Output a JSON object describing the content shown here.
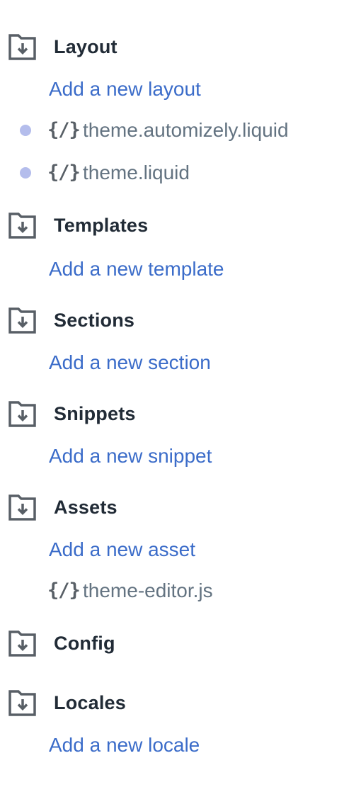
{
  "colors": {
    "link": "#3b6cc9",
    "heading": "#212b36",
    "file_text": "#637381",
    "icon": "#585f66",
    "dot": "#b4bdec"
  },
  "folders": [
    {
      "title": "Layout",
      "icon": "folder-download-icon",
      "add_label": "Add a new layout",
      "files": [
        {
          "name": "theme.automizely.liquid",
          "icon": "liquid-code-icon",
          "icon_text": "{/}",
          "dot": true
        },
        {
          "name": "theme.liquid",
          "icon": "liquid-code-icon",
          "icon_text": "{/}",
          "dot": true
        }
      ]
    },
    {
      "title": "Templates",
      "icon": "folder-download-icon",
      "add_label": "Add a new template",
      "files": []
    },
    {
      "title": "Sections",
      "icon": "folder-download-icon",
      "add_label": "Add a new section",
      "files": []
    },
    {
      "title": "Snippets",
      "icon": "folder-download-icon",
      "add_label": "Add a new snippet",
      "files": []
    },
    {
      "title": "Assets",
      "icon": "folder-download-icon",
      "add_label": "Add a new asset",
      "files": [
        {
          "name": "theme-editor.js",
          "icon": "liquid-code-icon",
          "icon_text": "{/}",
          "dot": false
        }
      ]
    },
    {
      "title": "Config",
      "icon": "folder-download-icon",
      "files": []
    },
    {
      "title": "Locales",
      "icon": "folder-download-icon",
      "add_label": "Add a new locale",
      "files": []
    }
  ]
}
